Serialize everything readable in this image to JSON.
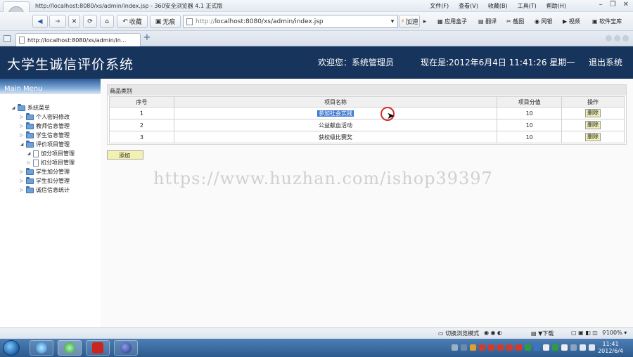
{
  "browser": {
    "window_title": "http://localhost:8080/xs/admin/index.jsp - 360安全浏览器 4.1 正式版",
    "menu_items": [
      "文件(F)",
      "查看(V)",
      "收藏(B)",
      "工具(T)",
      "帮助(H)"
    ],
    "back_label": "收藏",
    "favorites_label": "无痕",
    "address": "http://localhost:8080/xs/admin/index.jsp",
    "address_prefix": "http://",
    "address_host": "localhost:8080/xs/admin/index.jsp",
    "speed_label": "加速",
    "toolbar_items": [
      "应用盒子",
      "翻译",
      "截图",
      "网银",
      "视频",
      "软件宝库"
    ],
    "tab_title": "http://localhost:8080/xs/admin/in..."
  },
  "app": {
    "title": "大学生诚信评价系统",
    "welcome": "欢迎您：系统管理员",
    "now": "现在是:2012年6月4日  11:41:26 星期一",
    "logout": "退出系统"
  },
  "sidebar": {
    "header": "Main Menu",
    "root": "系统菜单",
    "items": [
      {
        "label": "个人密码修改",
        "type": "folder",
        "expanded": false
      },
      {
        "label": "教师信息管理",
        "type": "folder",
        "expanded": false
      },
      {
        "label": "学生信息管理",
        "type": "folder",
        "expanded": false
      },
      {
        "label": "评价项目管理",
        "type": "folder",
        "expanded": true
      },
      {
        "label": "加分项目管理",
        "type": "page",
        "expanded": false
      },
      {
        "label": "扣分项目管理",
        "type": "page",
        "expanded": false
      },
      {
        "label": "学生加分管理",
        "type": "folder",
        "expanded": false
      },
      {
        "label": "学生扣分管理",
        "type": "folder",
        "expanded": false
      },
      {
        "label": "诚信信息统计",
        "type": "folder",
        "expanded": false
      }
    ]
  },
  "table": {
    "caption": "商品类别",
    "headers": [
      "序号",
      "项目名称",
      "项目分值",
      "操作"
    ],
    "rows": [
      {
        "no": "1",
        "name": "参加社会实践",
        "score": "10",
        "action": "删除",
        "selected": true
      },
      {
        "no": "2",
        "name": "公益献血活动",
        "score": "10",
        "action": "删除",
        "selected": false
      },
      {
        "no": "3",
        "name": "获校级比赛奖",
        "score": "10",
        "action": "删除",
        "selected": false
      }
    ],
    "add_label": "添加"
  },
  "watermark": "https://www.huzhan.com/ishop39397",
  "statusbar": {
    "mode_label": "切换浏览模式",
    "download_label": "下载",
    "zoom": "100%"
  },
  "taskbar": {
    "time": "11:41",
    "date": "2012/6/4"
  },
  "colors": {
    "header_bg": "#17345c",
    "selection": "#3a78d1",
    "delete_btn_bg": "#f0f0b8"
  }
}
